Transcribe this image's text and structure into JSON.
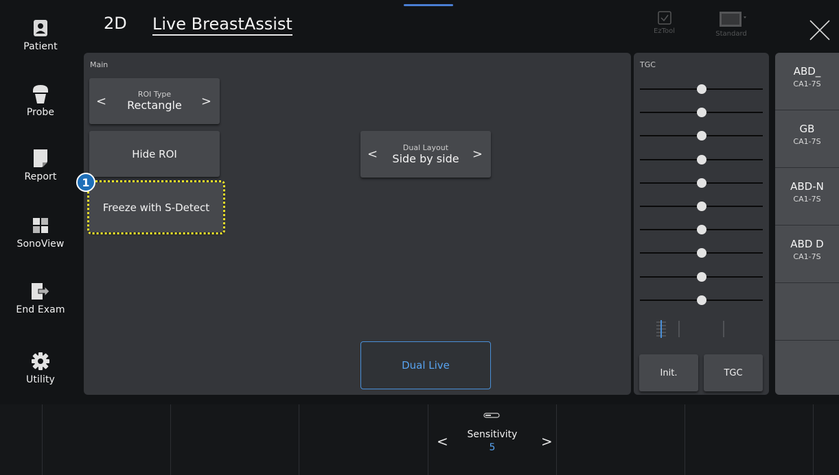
{
  "header": {
    "mode": "2D",
    "title": "Live BreastAssist",
    "tools": [
      {
        "label": "EzTool",
        "icon": "checkbox-icon"
      },
      {
        "label": "Standard",
        "icon": "monitor-icon"
      }
    ]
  },
  "sidebar": {
    "items": [
      {
        "label": "Patient",
        "icon": "patient-icon"
      },
      {
        "label": "Probe",
        "icon": "probe-icon"
      },
      {
        "label": "Report",
        "icon": "report-icon"
      },
      {
        "label": "SonoView",
        "icon": "sonoview-icon"
      },
      {
        "label": "End Exam",
        "icon": "end-exam-icon"
      },
      {
        "label": "Utility",
        "icon": "gear-icon"
      }
    ]
  },
  "main": {
    "caption": "Main",
    "roi_type": {
      "title": "ROI Type",
      "value": "Rectangle"
    },
    "hide_roi": "Hide ROI",
    "freeze": "Freeze with S-Detect",
    "callout": "1",
    "dual_layout": {
      "title": "Dual Layout",
      "value": "Side by side"
    },
    "dual_live": "Dual Live"
  },
  "tgc": {
    "caption": "TGC",
    "slider_count": 10,
    "init_label": "Init.",
    "tgc_label": "TGC"
  },
  "presets": [
    {
      "name": "ABD_",
      "probe": "CA1-7S"
    },
    {
      "name": "GB",
      "probe": "CA1-7S"
    },
    {
      "name": "ABD-N",
      "probe": "CA1-7S"
    },
    {
      "name": "ABD D",
      "probe": "CA1-7S"
    },
    {
      "name": "",
      "probe": ""
    },
    {
      "name": "",
      "probe": ""
    }
  ],
  "bottom": {
    "sensitivity": {
      "title": "Sensitivity",
      "value": "5"
    }
  },
  "colors": {
    "accent": "#58a3f0",
    "highlight": "#f1e52a",
    "callout": "#1e6fb8"
  }
}
